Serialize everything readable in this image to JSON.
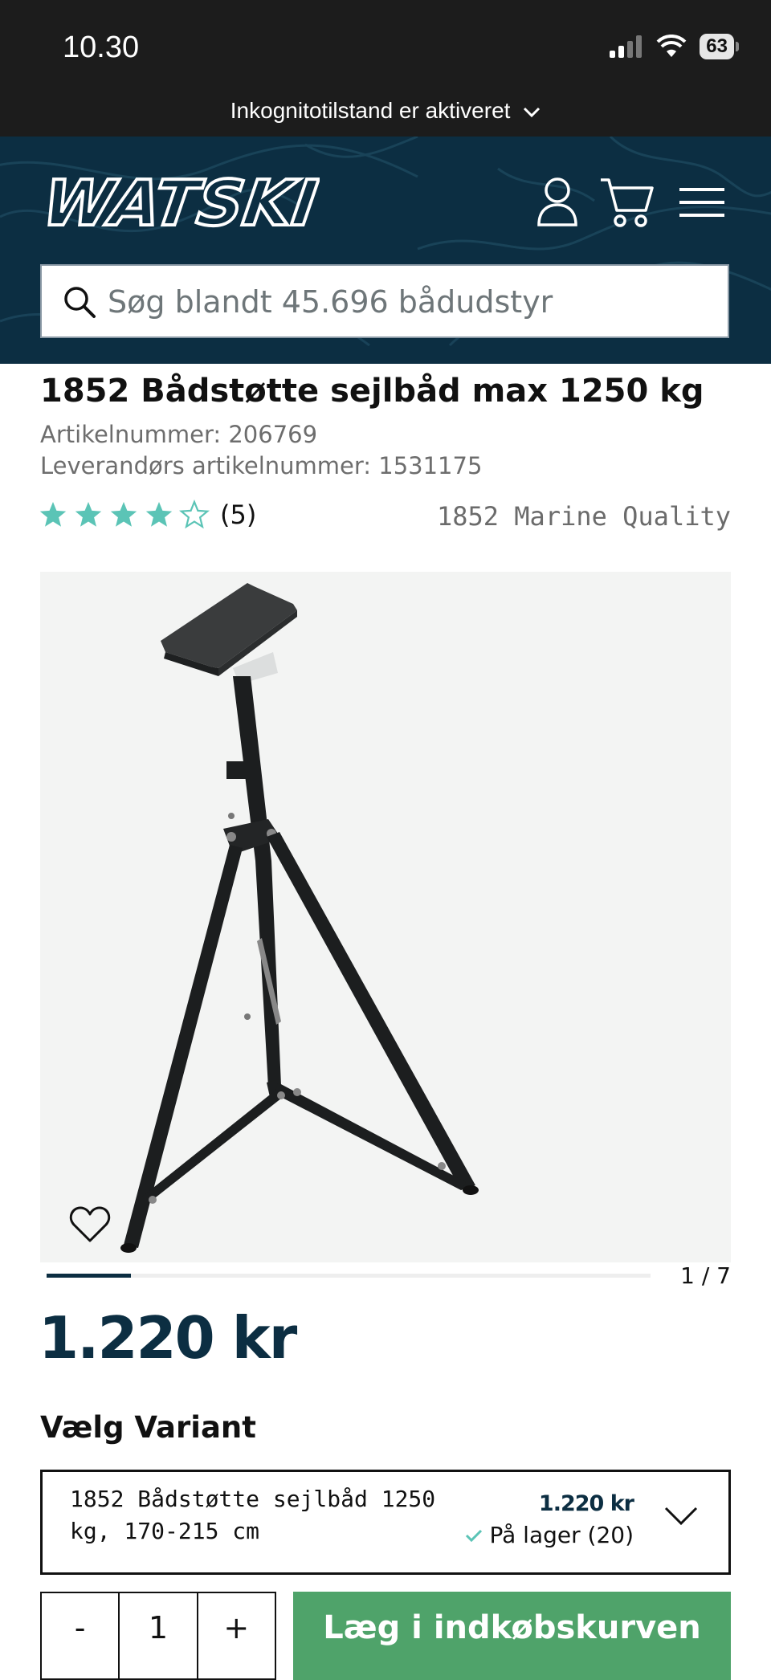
{
  "status_bar": {
    "time": "10.30",
    "battery": "63"
  },
  "browser": {
    "incognito_text": "Inkognitotilstand er aktiveret"
  },
  "header": {
    "logo_text": "WATSKI",
    "search_placeholder": "Søg blandt 45.696 bådudstyr",
    "icons": [
      "user-icon",
      "cart-icon",
      "menu-icon"
    ]
  },
  "product": {
    "title": "1852 Bådstøtte sejlbåd max 1250 kg",
    "article_number": "Artikelnummer: 206769",
    "supplier_article_number": "Leverandørs artikelnummer: 1531175",
    "rating_stars": 4,
    "rating_count": "(5)",
    "brand": "1852 Marine Quality",
    "gallery_counter": "1 / 7",
    "gallery_progress": 0.14,
    "price": "1.220 kr"
  },
  "variant": {
    "heading": "Vælg Variant",
    "name": "1852 Bådstøtte sejlbåd 1250 kg, 170-215 cm",
    "price": "1.220 kr",
    "stock": "På lager (20)"
  },
  "cart": {
    "minus": "-",
    "quantity": "1",
    "plus": "+",
    "add_button": "Læg i indkøbskurven"
  },
  "colors": {
    "brand_navy": "#0c2e42",
    "star_teal": "#5bc4b6",
    "cta_green": "#4fa36a"
  }
}
